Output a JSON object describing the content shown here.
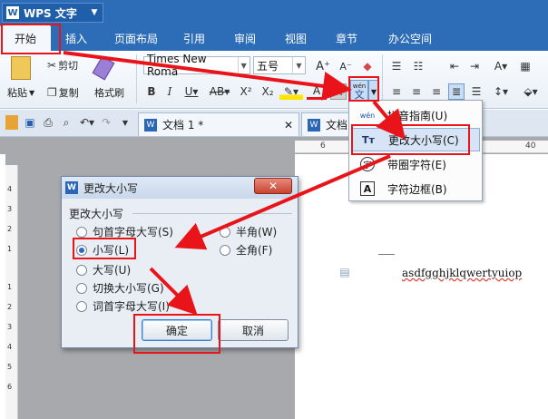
{
  "app": {
    "title": "WPS 文字",
    "logo": "W"
  },
  "menu": {
    "tabs": [
      "开始",
      "插入",
      "页面布局",
      "引用",
      "审阅",
      "视图",
      "章节",
      "办公空间"
    ]
  },
  "ribbon": {
    "cut_label": "剪切",
    "paste_label": "粘贴",
    "copy_label": "复制",
    "format_painter_label": "格式刷",
    "font_name": "Times New Roma",
    "font_size": "五号",
    "phonetic_label": "wén",
    "phonetic_char": "文"
  },
  "doc_tabs": {
    "active": "文档 1 *",
    "second": "文档"
  },
  "ruler": {
    "top_ticks": [
      "6",
      "40"
    ],
    "left_ticks": [
      "4",
      "3",
      "2",
      "1",
      "1",
      "2",
      "3",
      "4",
      "5",
      "6"
    ]
  },
  "dropdown": {
    "items": [
      {
        "label": "拼音指南(U)",
        "icon": "wén"
      },
      {
        "label": "更改大小写(C)",
        "icon": "Tт"
      },
      {
        "label": "带圈字符(E)",
        "icon": "字"
      },
      {
        "label": "字符边框(B)",
        "icon": "A"
      }
    ]
  },
  "dialog": {
    "title": "更改大小写",
    "group_label": "更改大小写",
    "options_left": [
      "句首字母大写(S)",
      "小写(L)",
      "大写(U)",
      "切换大小写(G)",
      "词首字母大写(I)"
    ],
    "options_right": [
      "半角(W)",
      "全角(F)"
    ],
    "selected": "小写(L)",
    "ok_label": "确定",
    "cancel_label": "取消"
  },
  "document": {
    "text": "asdfgghjklqwertyuiop"
  },
  "colors": {
    "accent": "#2d6db8",
    "annotation": "#e8141a"
  }
}
